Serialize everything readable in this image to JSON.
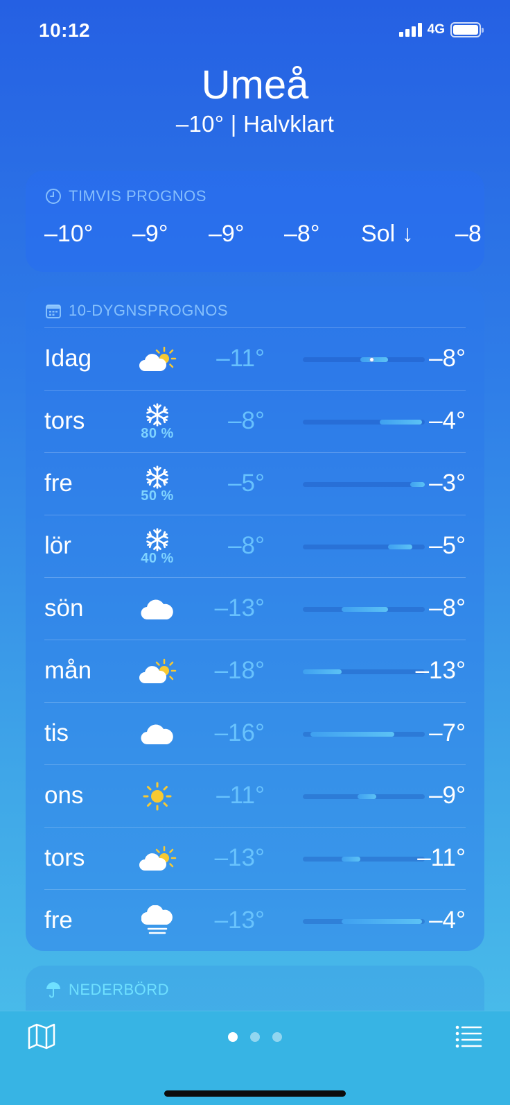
{
  "status": {
    "time": "10:12",
    "network": "4G"
  },
  "header": {
    "city": "Umeå",
    "summary": "–10°  |  Halvklart"
  },
  "hourly": {
    "title": "TIMVIS PROGNOS",
    "items": [
      {
        "label": "–10°"
      },
      {
        "label": "–9°"
      },
      {
        "label": "–9°"
      },
      {
        "label": "–8°"
      },
      {
        "label": "Sol ↓"
      },
      {
        "label": "–8"
      }
    ]
  },
  "daily": {
    "title": "10-DYGNSPROGNOS",
    "days": [
      {
        "day": "Idag",
        "icon": "partly-cloudy-icon",
        "precip": "",
        "low": "–11°",
        "high": "–8°",
        "range": [
          0.47,
          0.7
        ],
        "current": 0.56
      },
      {
        "day": "tors",
        "icon": "snow-icon",
        "precip": "80 %",
        "low": "–8°",
        "high": "–4°",
        "range": [
          0.63,
          0.98
        ]
      },
      {
        "day": "fre",
        "icon": "snow-icon",
        "precip": "50 %",
        "low": "–5°",
        "high": "–3°",
        "range": [
          0.88,
          1.0
        ]
      },
      {
        "day": "lör",
        "icon": "snow-icon",
        "precip": "40 %",
        "low": "–8°",
        "high": "–5°",
        "range": [
          0.7,
          0.9
        ]
      },
      {
        "day": "sön",
        "icon": "cloud-icon",
        "precip": "",
        "low": "–13°",
        "high": "–8°",
        "range": [
          0.32,
          0.7
        ]
      },
      {
        "day": "mån",
        "icon": "partly-cloudy-icon",
        "precip": "",
        "low": "–18°",
        "high": "–13°",
        "range": [
          0.0,
          0.32
        ]
      },
      {
        "day": "tis",
        "icon": "cloud-icon",
        "precip": "",
        "low": "–16°",
        "high": "–7°",
        "range": [
          0.06,
          0.75
        ]
      },
      {
        "day": "ons",
        "icon": "sun-icon",
        "precip": "",
        "low": "–11°",
        "high": "–9°",
        "range": [
          0.45,
          0.6
        ]
      },
      {
        "day": "tors",
        "icon": "partly-cloudy-icon",
        "precip": "",
        "low": "–13°",
        "high": "–11°",
        "range": [
          0.32,
          0.47
        ]
      },
      {
        "day": "fre",
        "icon": "fog-icon",
        "precip": "",
        "low": "–13°",
        "high": "–4°",
        "range": [
          0.32,
          0.98
        ]
      }
    ]
  },
  "precipitation": {
    "title": "NEDERBÖRD"
  },
  "pager": {
    "count": 3,
    "active": 0
  }
}
